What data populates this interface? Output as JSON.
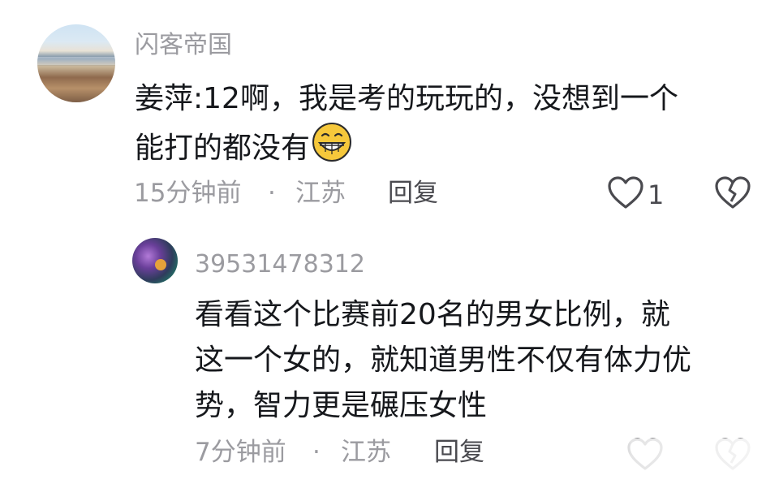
{
  "comments": [
    {
      "username": "闪客帝国",
      "text_lines": [
        "姜萍:12啊，我是考的玩玩的，没想到一个",
        "能打的都没有"
      ],
      "emoji": "grinning-face",
      "time": "15分钟前",
      "separator": "·",
      "location": "江苏",
      "reply": "回复",
      "like_count": "1"
    },
    {
      "username": "39531478312",
      "text_lines": [
        "看看这个比赛前20名的男女比例，就",
        "这一个女的，就知道男性不仅有体力优",
        "势，智力更是碾压女性"
      ],
      "time": "7分钟前",
      "separator": "·",
      "location": "江苏",
      "reply": "回复"
    }
  ],
  "icons": {
    "like": "heart-outline-icon",
    "dislike": "broken-heart-icon",
    "emoji": "grinning-face-emoji"
  },
  "colors": {
    "text": "#16181c",
    "muted": "#9b9ba0",
    "reply": "#4a4a4f",
    "background": "#ffffff"
  }
}
